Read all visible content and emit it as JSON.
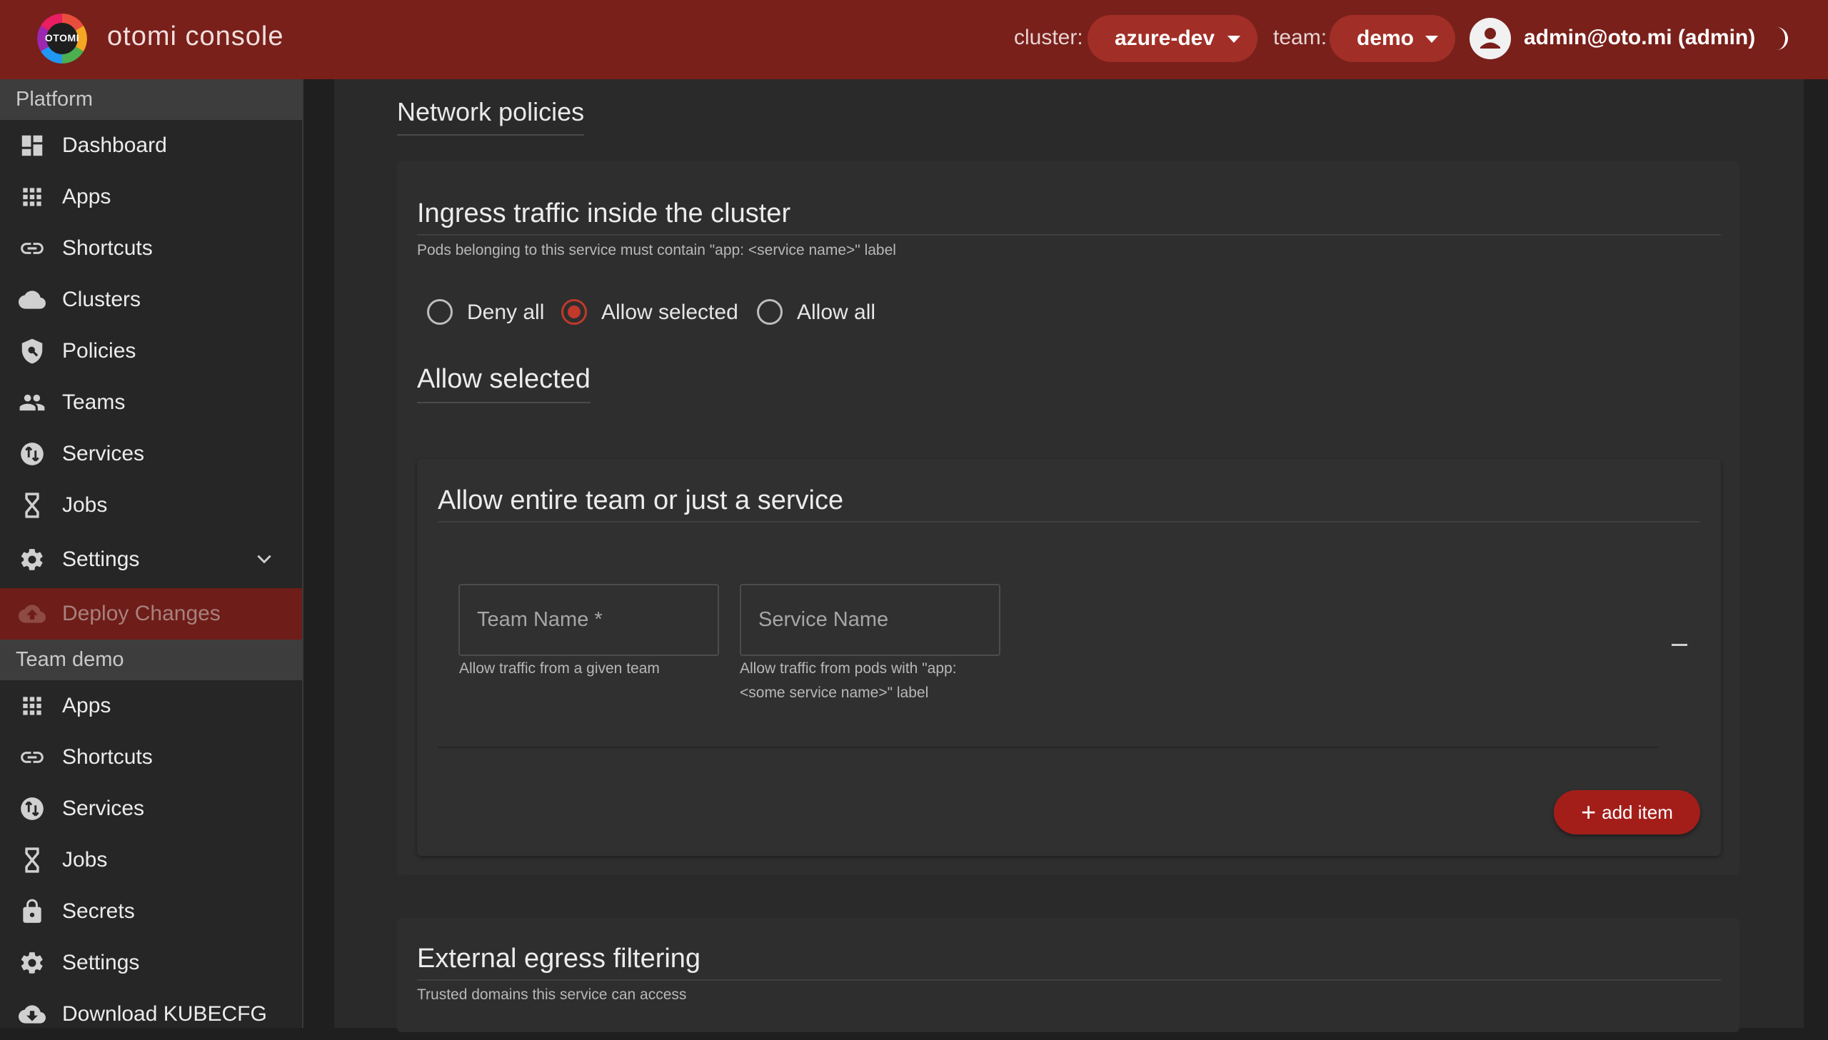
{
  "header": {
    "logo_text": "OTOMI",
    "app_title": "otomi console",
    "cluster_label": "cluster:",
    "cluster_value": "azure-dev",
    "team_label": "team:",
    "team_value": "demo",
    "user": "admin@oto.mi (admin)"
  },
  "sidebar": {
    "platform_section": "Platform",
    "platform_items": [
      {
        "label": "Dashboard",
        "icon": "dashboard-icon"
      },
      {
        "label": "Apps",
        "icon": "apps-grid-icon"
      },
      {
        "label": "Shortcuts",
        "icon": "link-icon"
      },
      {
        "label": "Clusters",
        "icon": "cloud-icon"
      },
      {
        "label": "Policies",
        "icon": "shield-search-icon"
      },
      {
        "label": "Teams",
        "icon": "people-icon"
      },
      {
        "label": "Services",
        "icon": "swap-circle-icon"
      },
      {
        "label": "Jobs",
        "icon": "hourglass-icon"
      },
      {
        "label": "Settings",
        "icon": "gear-icon"
      }
    ],
    "deploy": "Deploy Changes",
    "team_section": "Team demo",
    "team_items": [
      {
        "label": "Apps",
        "icon": "apps-grid-icon"
      },
      {
        "label": "Shortcuts",
        "icon": "link-icon"
      },
      {
        "label": "Services",
        "icon": "swap-circle-icon"
      },
      {
        "label": "Jobs",
        "icon": "hourglass-icon"
      },
      {
        "label": "Secrets",
        "icon": "lock-icon"
      },
      {
        "label": "Settings",
        "icon": "gear-icon"
      },
      {
        "label": "Download KUBECFG",
        "icon": "cloud-download-icon"
      }
    ]
  },
  "main": {
    "network_title": "Network policies",
    "ingress_title": "Ingress traffic inside the cluster",
    "ingress_desc": "Pods belonging to this service must contain \"app: <service name>\" label",
    "radio_options": [
      "Deny all",
      "Allow selected",
      "Allow all"
    ],
    "radio_selected": "Allow selected",
    "allow_selected_title": "Allow selected",
    "entire_team_title": "Allow entire team or just a service",
    "team_name_placeholder": "Team Name *",
    "service_name_placeholder": "Service Name",
    "team_helper": "Allow traffic from a given team",
    "service_helper_1": "Allow traffic from pods with \"app:",
    "service_helper_2": "<some service name>\" label",
    "add_item": "add item",
    "egress_title": "External egress filtering",
    "egress_desc": "Trusted domains this service can access"
  },
  "colors": {
    "header_bg": "#79201b",
    "accent": "#a31e19",
    "sidebar_bg": "#262626",
    "main_bg": "#2a2a2a"
  }
}
